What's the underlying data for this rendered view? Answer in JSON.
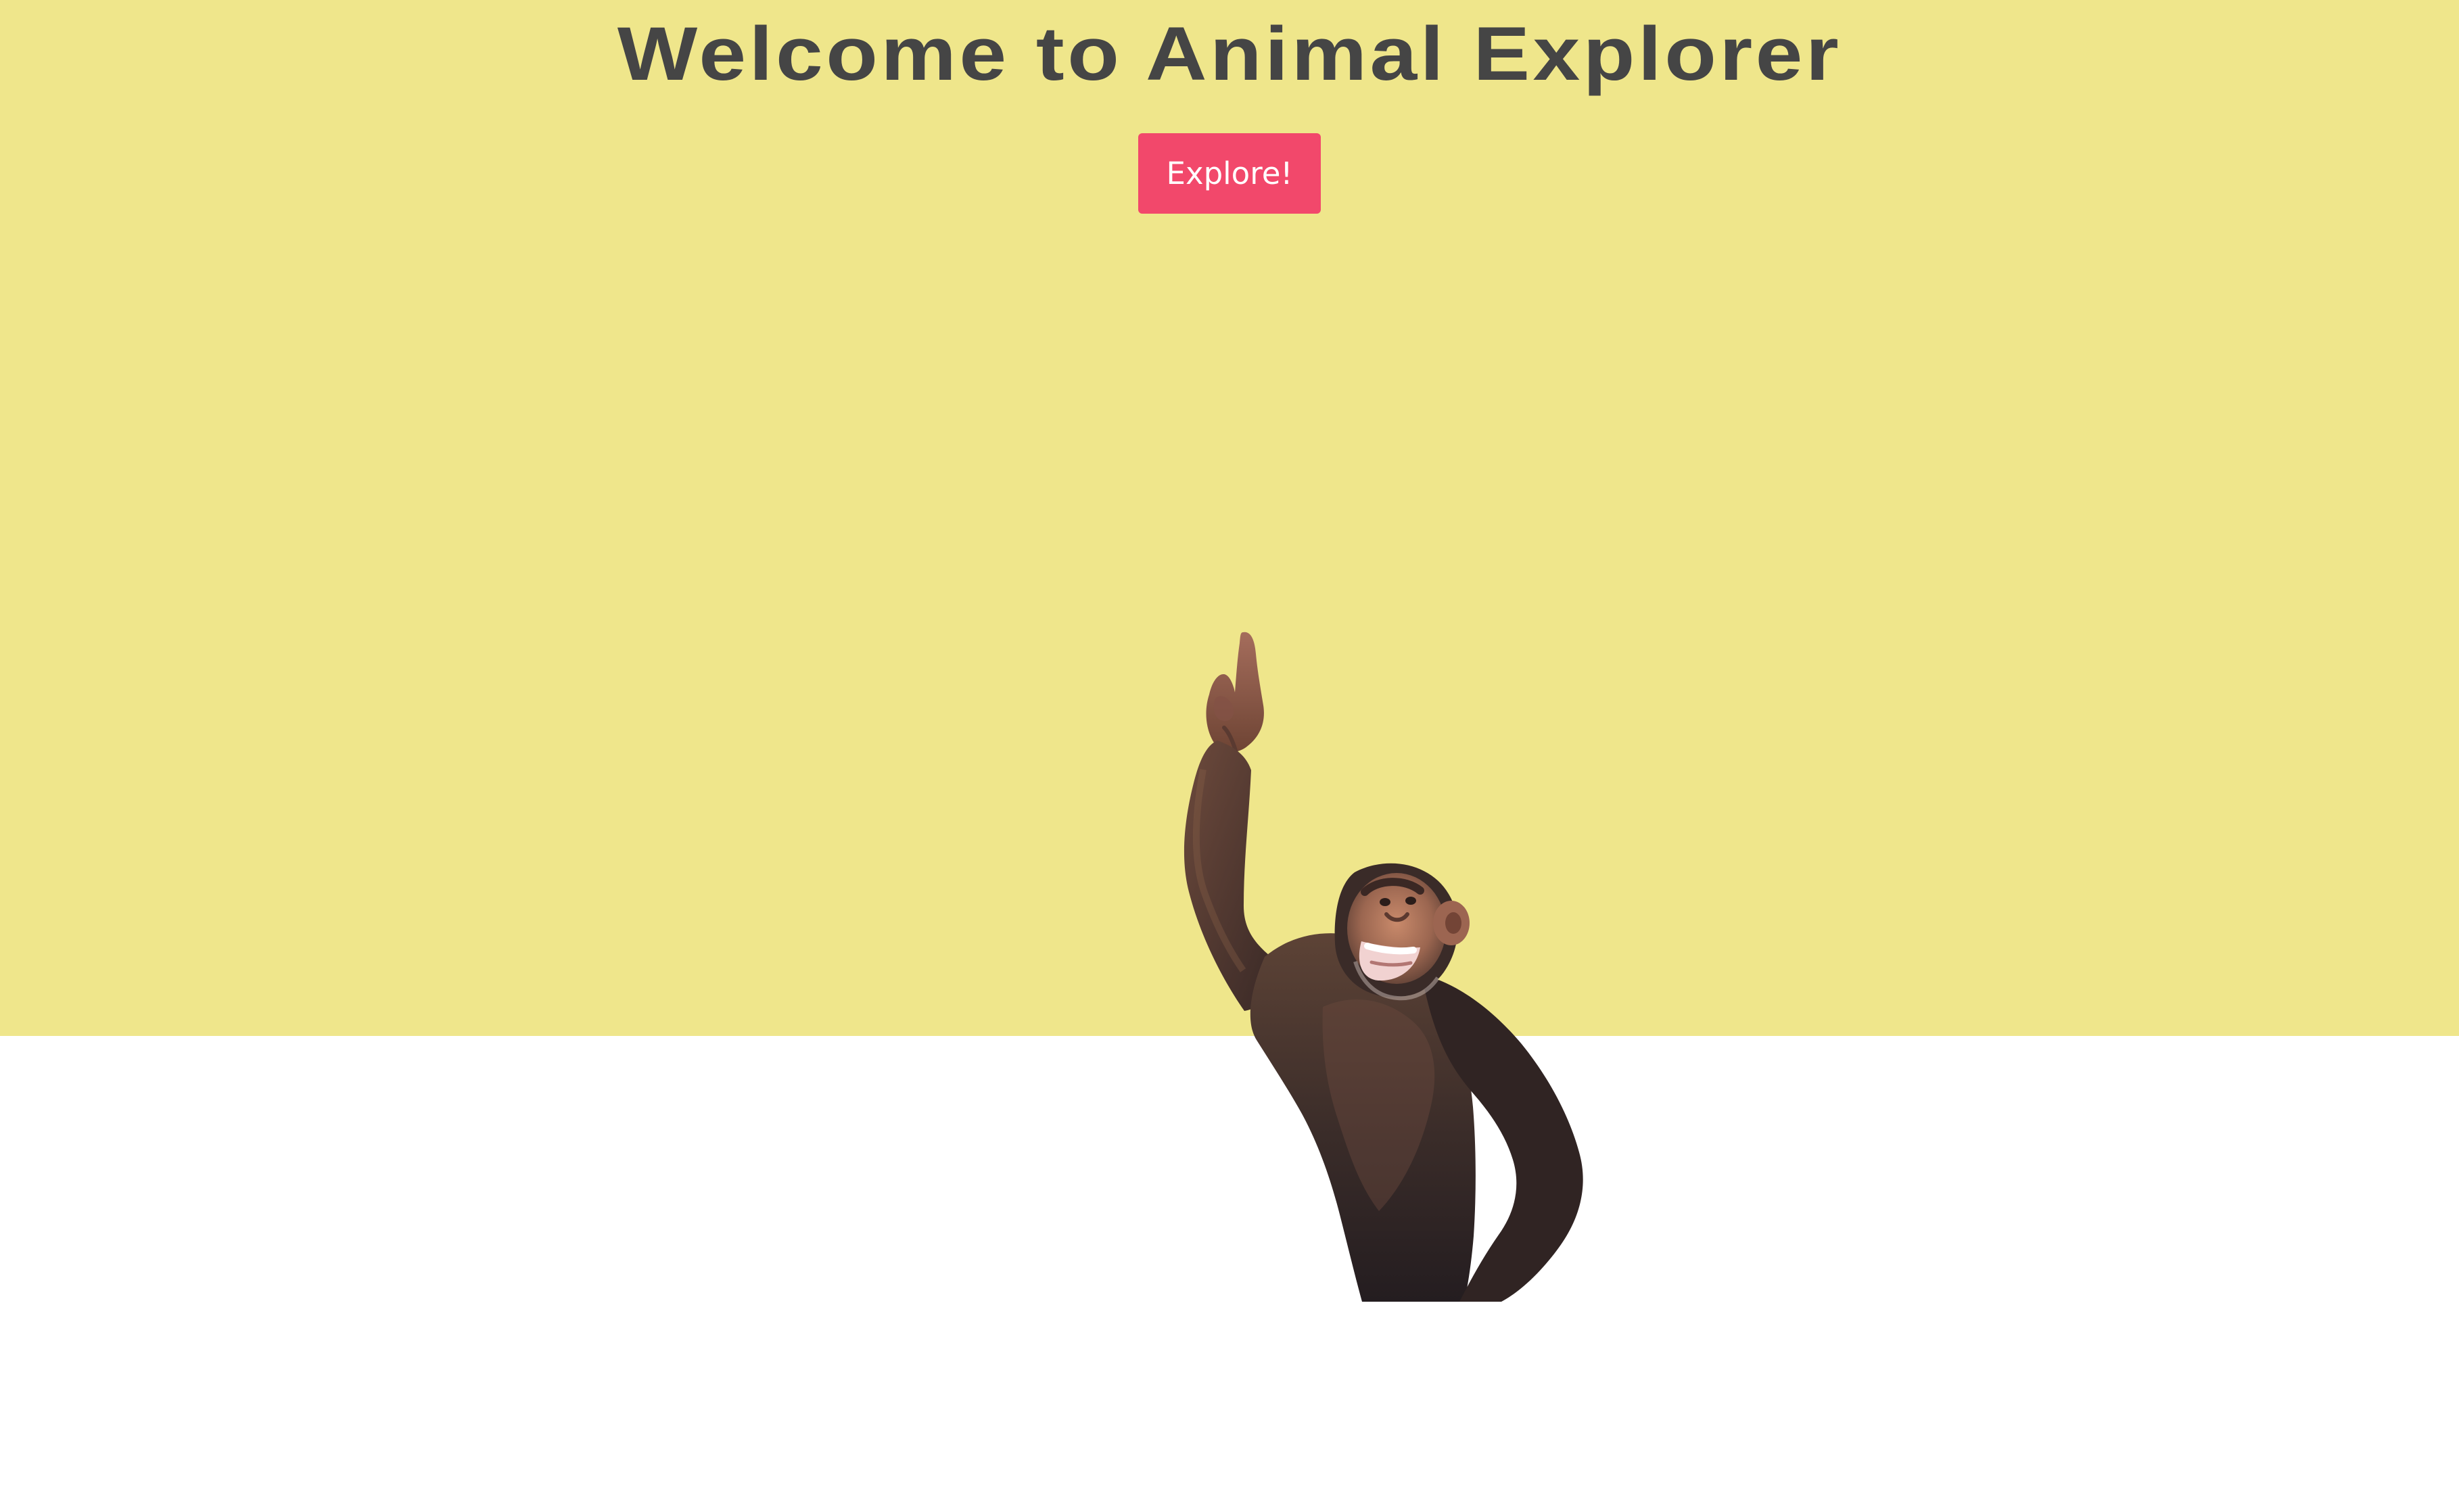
{
  "header": {
    "title": "Welcome to Animal Explorer"
  },
  "hero": {
    "background_color": "#efe68b",
    "explore_button_label": "Explore!",
    "explore_button_color": "#f2486b"
  },
  "image": {
    "subject": "chimpanzee"
  }
}
